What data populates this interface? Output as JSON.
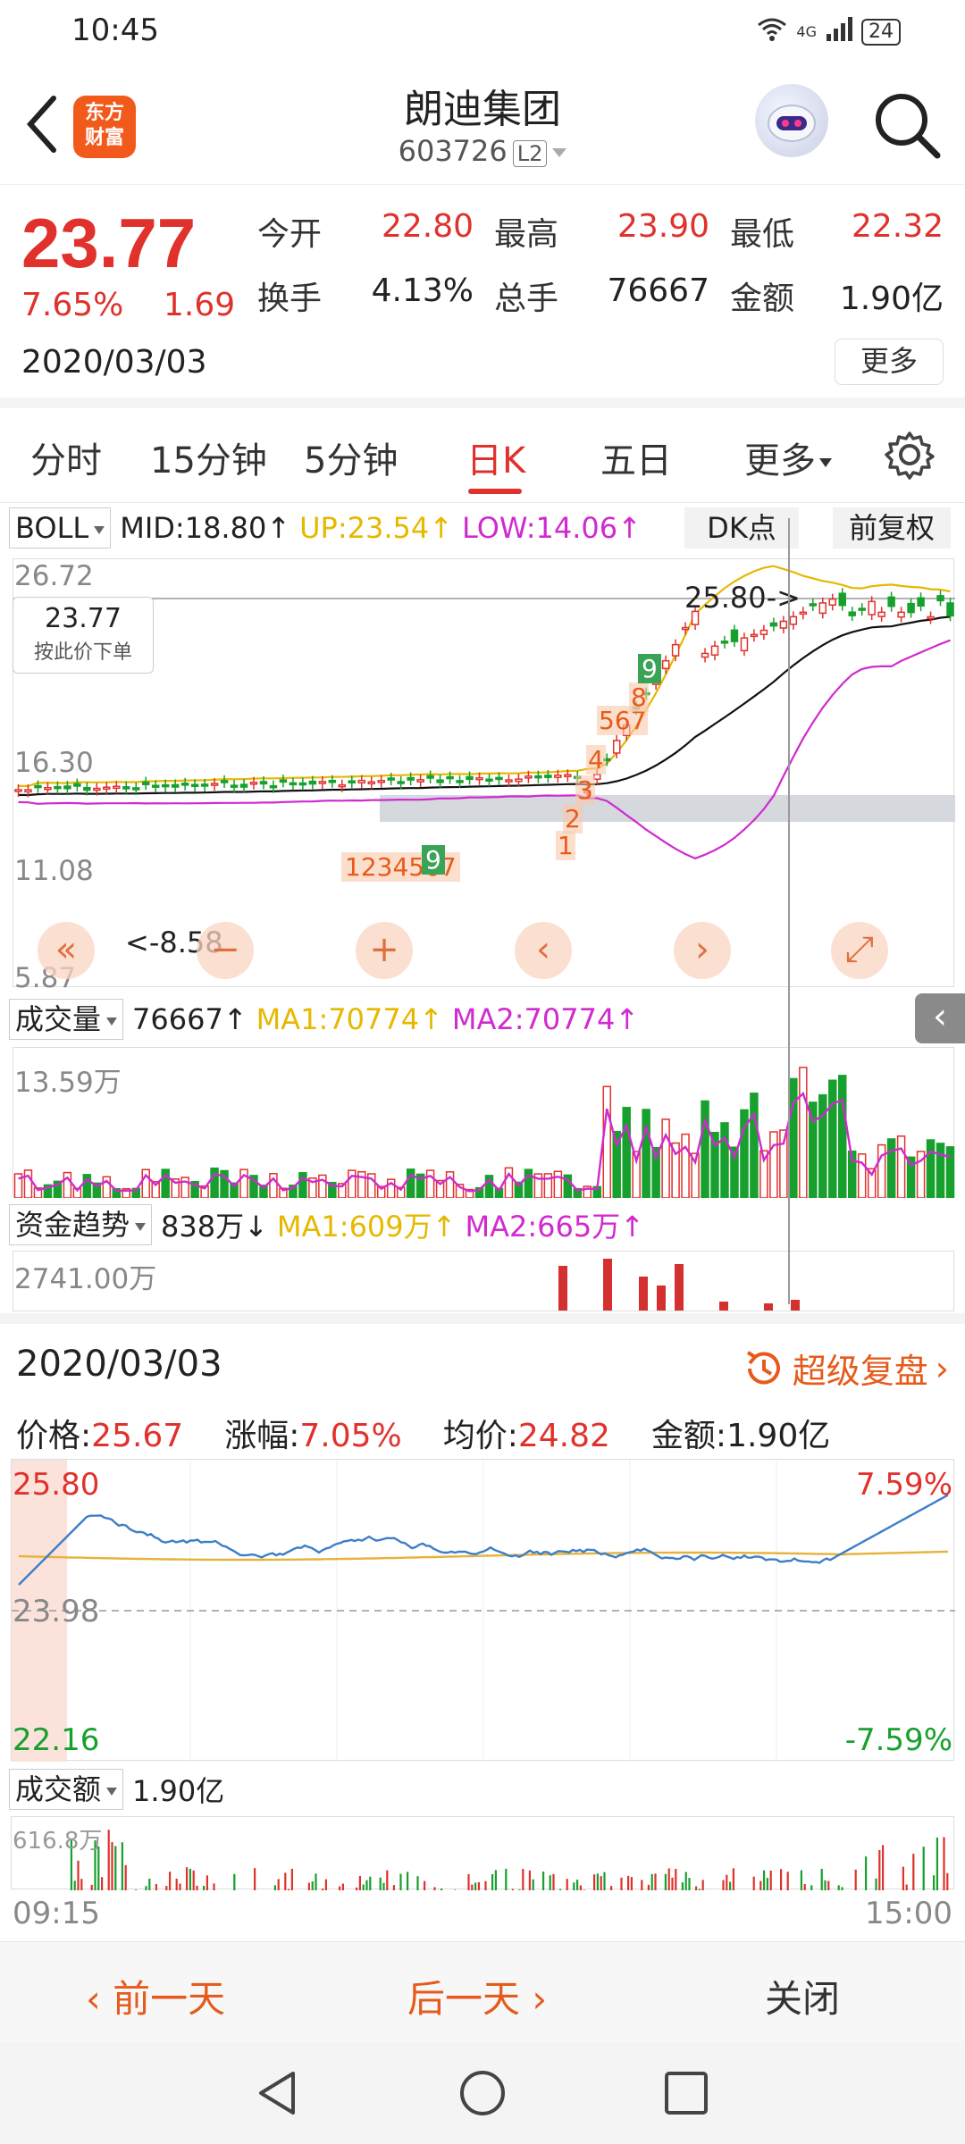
{
  "status": {
    "time": "10:45",
    "net": "4G",
    "battery": "24"
  },
  "header": {
    "logo_line1": "东方",
    "logo_line2": "财富",
    "name": "朗迪集团",
    "code": "603726",
    "level_badge": "L2"
  },
  "quote": {
    "price": "23.77",
    "pct": "7.65%",
    "change": "1.69",
    "date": "2020/03/03",
    "open_label": "今开",
    "open": "22.80",
    "high_label": "最高",
    "high": "23.90",
    "low_label": "最低",
    "low": "22.32",
    "turnover_label": "换手",
    "turnover": "4.13%",
    "volume_label": "总手",
    "volume": "76667",
    "amount_label": "金额",
    "amount": "1.90亿",
    "more": "更多"
  },
  "tabs": {
    "t1": "分时",
    "t2": "15分钟",
    "t3": "5分钟",
    "t4": "日K",
    "t5": "五日",
    "t6": "更多"
  },
  "boll": {
    "name": "BOLL",
    "mid": "MID:18.80↑",
    "up": "UP:23.54↑",
    "low": "LOW:14.06↑",
    "dk": "DK点",
    "fq": "前复权"
  },
  "kline": {
    "y_top": "26.72",
    "y_mid": "16.30",
    "y_low": "11.08",
    "y_bottom": "5.87",
    "high_note": "25.80->",
    "low_note": "<-8.58",
    "tag_price": "23.77",
    "tag_text": "按此价下单",
    "seq1": "1234567",
    "seq1_end": "9",
    "s1": "1",
    "s2": "2",
    "s3": "3",
    "s4": "4",
    "s567": "567",
    "s8": "8",
    "s9": "9"
  },
  "volume": {
    "name": "成交量",
    "val": "76667↑",
    "ma1": "MA1:70774↑",
    "ma2": "MA2:70774↑",
    "y_top": "13.59万"
  },
  "fund": {
    "name": "资金趋势",
    "val": "838万↓",
    "ma1": "MA1:609万↑",
    "ma2": "MA2:665万↑",
    "y_top": "2741.00万"
  },
  "panel": {
    "date": "2020/03/03",
    "replay": "超级复盘",
    "price_lbl": "价格:",
    "price": "25.67",
    "pct_lbl": "涨幅:",
    "pct": "7.05%",
    "avg_lbl": "均价:",
    "avg": "24.82",
    "amt_lbl": "金额:",
    "amt": "1.90亿",
    "y_top": "25.80",
    "y_mid": "23.98",
    "y_bottom": "22.16",
    "pct_top": "7.59%",
    "pct_bottom": "-7.59%",
    "vol_name": "成交额",
    "vol_val": "1.90亿",
    "vol_top": "616.8万",
    "t_start": "09:15",
    "t_end": "15:00"
  },
  "footer": {
    "prev": "前一天",
    "next": "后一天",
    "close": "关闭"
  },
  "colors": {
    "up": "#e0312c",
    "down": "#17a02d",
    "accent": "#e65b1c",
    "ma1": "#e6b800",
    "ma2": "#d02ad0"
  },
  "chart_data": {
    "type": "line",
    "title": "",
    "x": [
      "09:15",
      "15:00"
    ],
    "series": [],
    "ylim": [
      22.16,
      25.8
    ]
  }
}
